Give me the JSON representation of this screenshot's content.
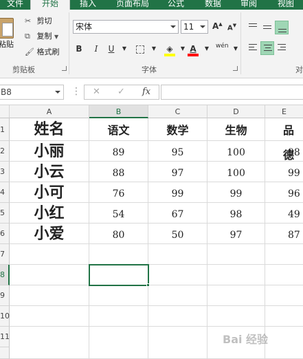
{
  "ribbon_tabs": [
    {
      "label": "文件"
    },
    {
      "label": "开始"
    },
    {
      "label": "插入"
    },
    {
      "label": "页面布局"
    },
    {
      "label": "公式"
    },
    {
      "label": "数据"
    },
    {
      "label": "审阅"
    },
    {
      "label": "视图"
    }
  ],
  "clipboard": {
    "paste_label": "粘贴",
    "cut_label": "剪切",
    "copy_label": "复制",
    "format_painter_label": "格式刷",
    "group_label": "剪贴板"
  },
  "font": {
    "font_name": "宋体",
    "font_size": "11",
    "bold": "B",
    "italic": "I",
    "underline": "U",
    "grow": "A",
    "shrink": "A",
    "fill_color": "#ffff00",
    "font_color": "#ff0000",
    "phonetic": "wén",
    "group_label": "字体"
  },
  "alignment": {
    "group_label": "对"
  },
  "formula_bar": {
    "name_box": "B8",
    "cancel": "✕",
    "enter": "✓",
    "fx": "fx",
    "value": ""
  },
  "columns": [
    "A",
    "B",
    "C",
    "D",
    "E"
  ],
  "selected_column": "B",
  "rows": [
    "1",
    "2",
    "3",
    "4",
    "5",
    "6",
    "7",
    "8",
    "9",
    "10",
    "11"
  ],
  "selected_row": "8",
  "table": {
    "headers": [
      "姓名",
      "语文",
      "数学",
      "生物",
      "品德"
    ],
    "rows": [
      [
        "小丽",
        "89",
        "95",
        "100",
        "98"
      ],
      [
        "小云",
        "88",
        "97",
        "100",
        "99"
      ],
      [
        "小可",
        "76",
        "99",
        "99",
        "96"
      ],
      [
        "小红",
        "54",
        "67",
        "98",
        "49"
      ],
      [
        "小爱",
        "80",
        "50",
        "97",
        "87"
      ]
    ]
  },
  "watermark": "Bai 经验"
}
